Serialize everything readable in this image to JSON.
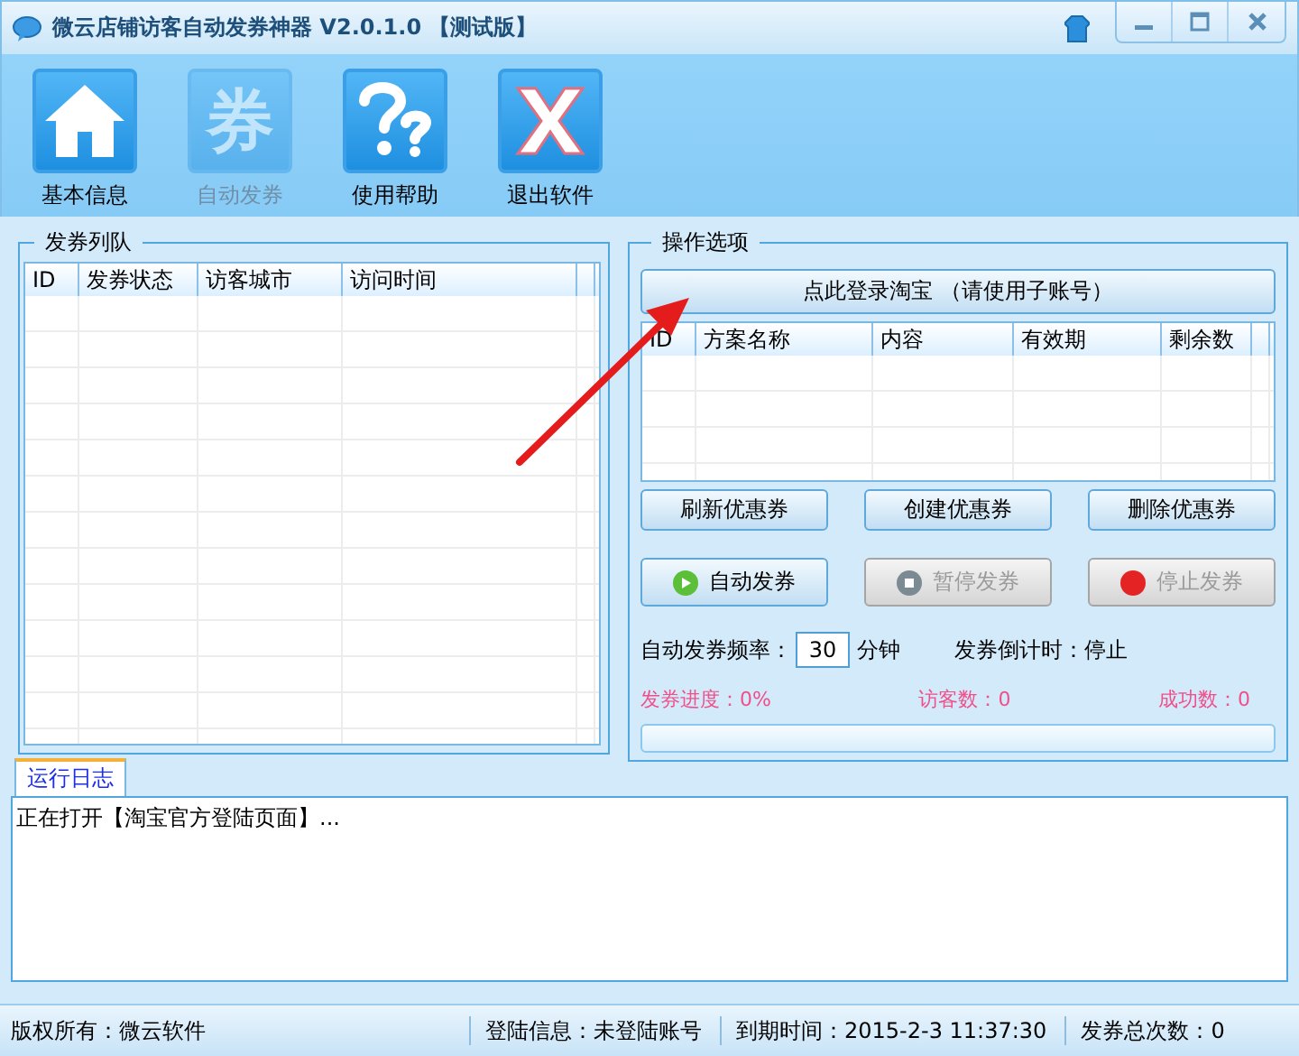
{
  "window": {
    "title": "微云店铺访客自动发券神器 V2.0.1.0 【测试版】"
  },
  "toolbar": [
    {
      "label": "基本信息",
      "kind": "home",
      "disabled": false
    },
    {
      "label": "自动发券",
      "kind": "glyph",
      "glyph": "券",
      "disabled": true
    },
    {
      "label": "使用帮助",
      "kind": "help",
      "disabled": false
    },
    {
      "label": "退出软件",
      "kind": "exit",
      "disabled": false
    }
  ],
  "queue": {
    "title": "发券列队",
    "columns": [
      "ID",
      "发券状态",
      "访客城市",
      "访问时间"
    ]
  },
  "options": {
    "title": "操作选项",
    "login_button": "点此登录淘宝 （请使用子账号）",
    "coupon_columns": [
      "ID",
      "方案名称",
      "内容",
      "有效期",
      "剩余数"
    ],
    "coupon_buttons": [
      "刷新优惠券",
      "创建优惠券",
      "删除优惠券"
    ],
    "actions": [
      {
        "label": "自动发券",
        "kind": "play",
        "disabled": false
      },
      {
        "label": "暂停发券",
        "kind": "pause",
        "disabled": true
      },
      {
        "label": "停止发券",
        "kind": "stop",
        "disabled": true
      }
    ],
    "frequency_label": "自动发券频率：",
    "frequency_value": "30",
    "frequency_unit": "分钟",
    "countdown": "发券倒计时：停止",
    "stats": [
      "发券进度：0%",
      "访客数：0",
      "成功数：0"
    ],
    "progress": {
      "level": 0
    }
  },
  "log": {
    "tabs": [
      {
        "label": "运行日志",
        "selected": true
      }
    ],
    "lines": [
      "正在打开【淘宝官方登陆页面】..."
    ]
  },
  "status_bar": [
    "版权所有：微云软件",
    "登陆信息：未登陆账号",
    "到期时间：2015-2-3 11:37:30",
    "发券总次数：0"
  ]
}
